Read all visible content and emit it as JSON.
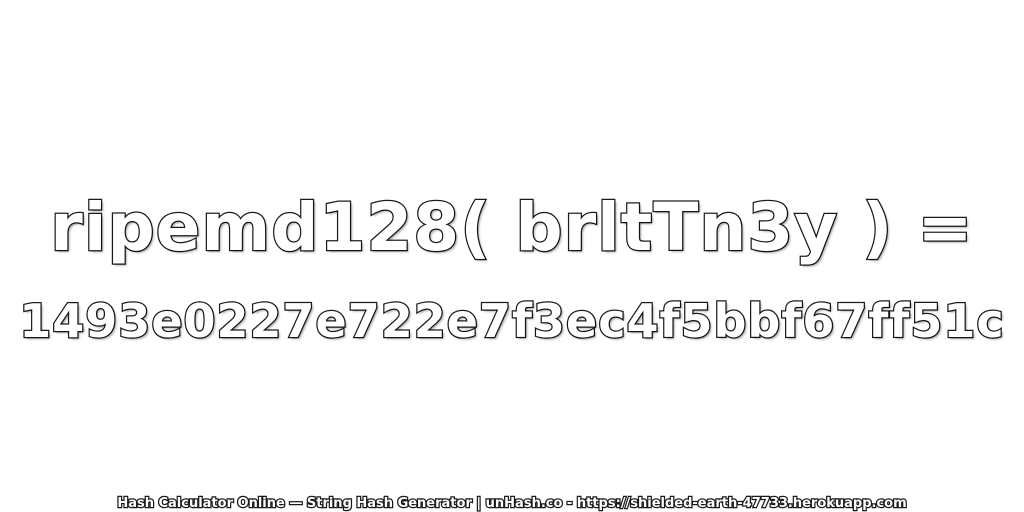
{
  "expression": "ripemd128( brltTn3y ) =",
  "hash_value": "1493e0227e722e7f3ec4f5bbf67ff51c",
  "footer_text": "Hash Calculator Online — String Hash Generator | unHash.co - https://shielded-earth-47733.herokuapp.com",
  "colors": {
    "background": "#ffffff",
    "text_fill": "#ffffff",
    "text_outline": "#1a1a1a"
  }
}
